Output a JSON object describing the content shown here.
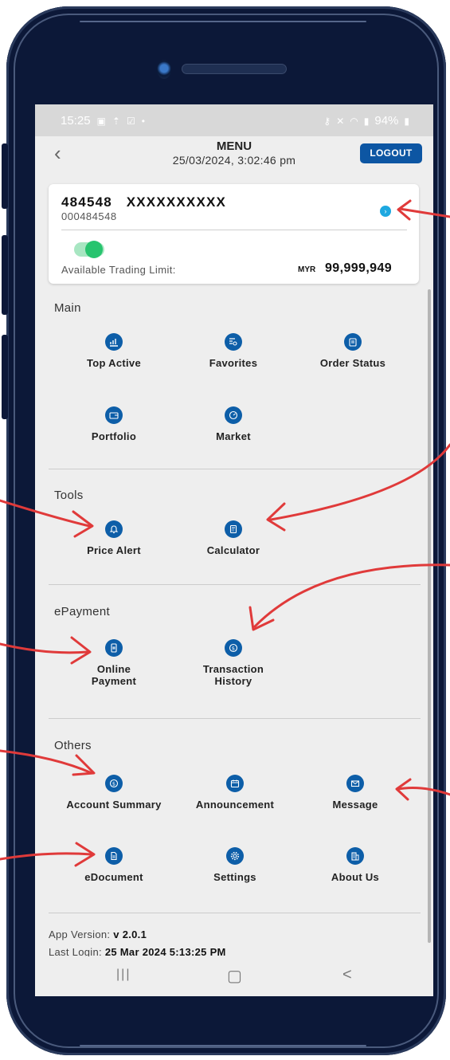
{
  "status_bar": {
    "time": "15:25",
    "battery": "94%",
    "icons_left": [
      "gallery-icon",
      "upload-icon",
      "mail-icon",
      "dot-icon"
    ],
    "icons_right": [
      "key-icon",
      "mute-icon",
      "wifi-icon",
      "signal-icon",
      "battery-icon"
    ]
  },
  "header": {
    "title": "MENU",
    "datetime": "25/03/2024, 3:02:46 pm",
    "logout_label": "LOGOUT"
  },
  "account": {
    "name": "484548   XXXXXXXXXX",
    "number": "000484548",
    "trading_limit_label": "Available Trading Limit:",
    "currency": "MYR",
    "trading_limit_value": "99,999,949",
    "toggle_on": true
  },
  "sections": {
    "main": {
      "title": "Main",
      "items": [
        {
          "label": "Top Active",
          "icon": "chart-icon"
        },
        {
          "label": "Favorites",
          "icon": "search-list-icon"
        },
        {
          "label": "Order Status",
          "icon": "clipboard-icon"
        },
        {
          "label": "Portfolio",
          "icon": "wallet-icon"
        },
        {
          "label": "Market",
          "icon": "gauge-icon"
        }
      ]
    },
    "tools": {
      "title": "Tools",
      "items": [
        {
          "label": "Price Alert",
          "icon": "bell-icon"
        },
        {
          "label": "Calculator",
          "icon": "calculator-icon"
        }
      ]
    },
    "epayment": {
      "title": "ePayment",
      "items": [
        {
          "label": "Online Payment",
          "line1": "Online",
          "line2": "Payment",
          "icon": "phone-payment-icon"
        },
        {
          "label": "Transaction History",
          "line1": "Transaction",
          "line2": "History",
          "icon": "dollar-history-icon"
        }
      ]
    },
    "others": {
      "title": "Others",
      "items": [
        {
          "label": "Account Summary",
          "icon": "dollar-coin-icon"
        },
        {
          "label": "Announcement",
          "icon": "calendar-icon"
        },
        {
          "label": "Message",
          "icon": "envelope-icon"
        },
        {
          "label": "eDocument",
          "icon": "document-icon"
        },
        {
          "label": "Settings",
          "icon": "gear-icon"
        },
        {
          "label": "About Us",
          "icon": "building-icon"
        }
      ]
    }
  },
  "footer": {
    "version_label": "App Version:",
    "version_value": "v 2.0.1",
    "last_login_label": "Last Login:",
    "last_login_value": "25 Mar 2024 5:13:25 PM"
  },
  "nav": {
    "recent": "|||",
    "home": "▢",
    "back": "<"
  },
  "colors": {
    "accent": "#0d5ea8",
    "frame": "#0c1838",
    "annotation": "#e03a3a",
    "toggle": "#27c46e"
  }
}
